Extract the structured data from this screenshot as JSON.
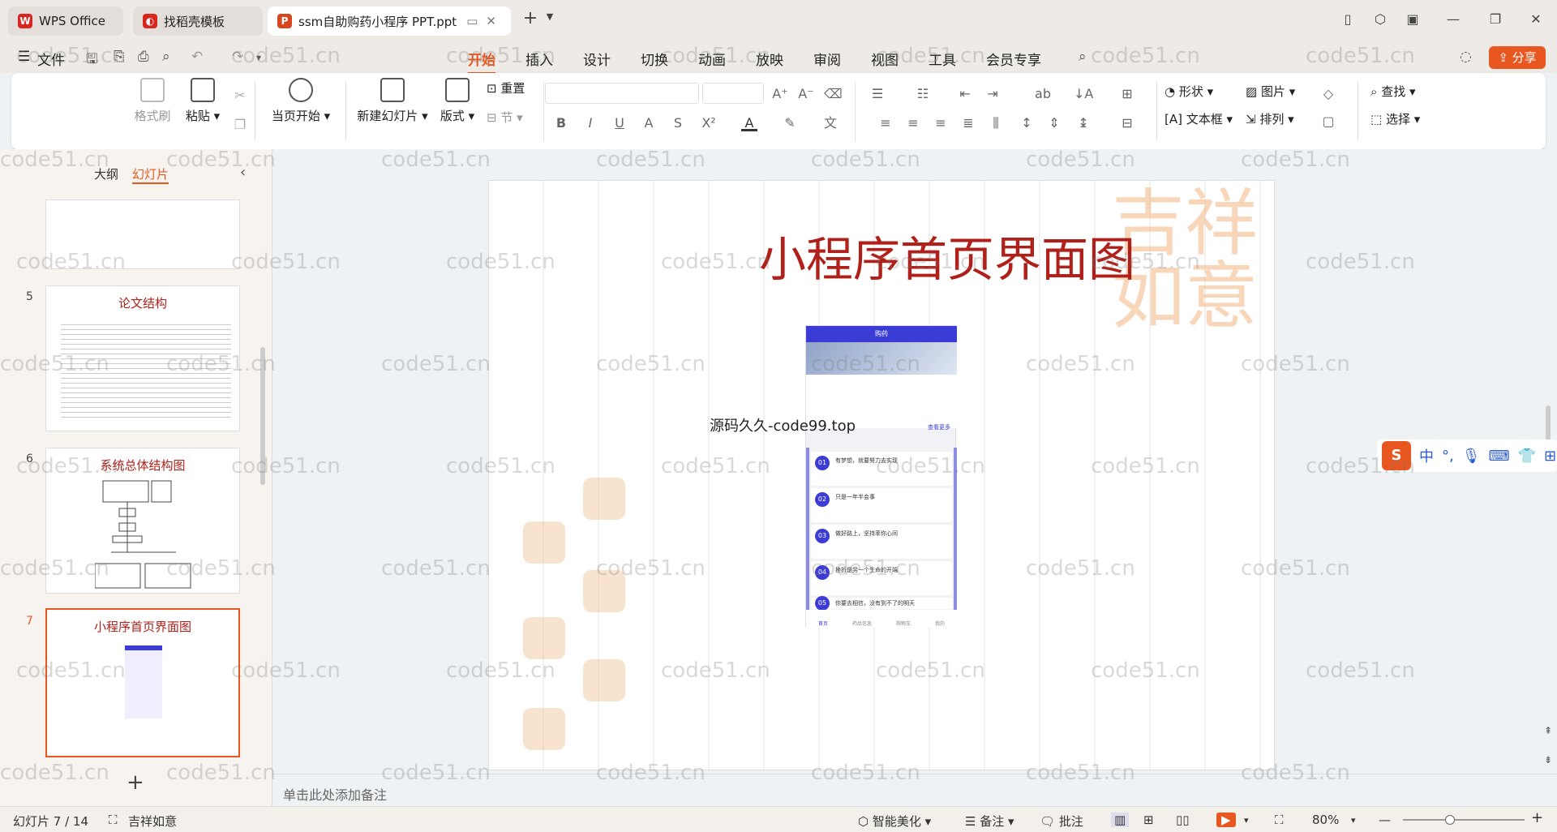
{
  "titlebar": {
    "tabs": [
      {
        "label": "WPS Office",
        "icon": "wps-logo-icon"
      },
      {
        "label": "找稻壳模板",
        "icon": "docer-icon"
      },
      {
        "label": "ssm自助购药小程序 PPT.ppt",
        "icon": "ppt-icon"
      }
    ]
  },
  "menubar": {
    "file_label": "文件",
    "tabs": [
      "开始",
      "插入",
      "设计",
      "切换",
      "动画",
      "放映",
      "审阅",
      "视图",
      "工具",
      "会员专享"
    ],
    "active_tab": "开始",
    "share_label": "分享"
  },
  "ribbon": {
    "format_painter": "格式刷",
    "paste": "粘贴",
    "play_from_current": "当页开始",
    "new_slide": "新建幻灯片",
    "layout": "版式",
    "reset": "重置",
    "section": "节",
    "shape": "形状",
    "picture": "图片",
    "textbox": "文本框",
    "arrange": "排列",
    "find": "查找",
    "select": "选择"
  },
  "leftpanel": {
    "outline_tab": "大纲",
    "slides_tab": "幻灯片",
    "thumbs": [
      {
        "num": "5",
        "title": "论文结构"
      },
      {
        "num": "6",
        "title": "系统总体结构图"
      },
      {
        "num": "7",
        "title": "小程序首页界面图"
      }
    ]
  },
  "slide": {
    "title": "小程序首页界面图",
    "overlay_text": "源码久久-code99.top",
    "phone": {
      "header": "购药",
      "more": "查看更多",
      "cards": [
        {
          "n": "01",
          "t": "有梦想，就要努力去实现"
        },
        {
          "n": "02",
          "t": "只是一年半会事"
        },
        {
          "n": "03",
          "t": "做好路上，坚持率你心间"
        },
        {
          "n": "04",
          "t": "挫折是另一个生命的开端"
        },
        {
          "n": "05",
          "t": "你要去相信，没有到不了的明天"
        }
      ],
      "tabbar": [
        "首页",
        "药品信息",
        "购物车",
        "我的"
      ]
    }
  },
  "notes": {
    "placeholder": "单击此处添加备注"
  },
  "status": {
    "slide_counter": "幻灯片 7 / 14",
    "theme": "吉祥如意",
    "smart_beautify": "智能美化",
    "notes": "备注",
    "comments": "批注",
    "zoom": "80%"
  },
  "ime": {
    "lang": "中"
  },
  "watermark": "code51.cn",
  "colors": {
    "accent": "#e8571f",
    "slide_title": "#b0201a",
    "phone_header": "#3b3bd6"
  }
}
